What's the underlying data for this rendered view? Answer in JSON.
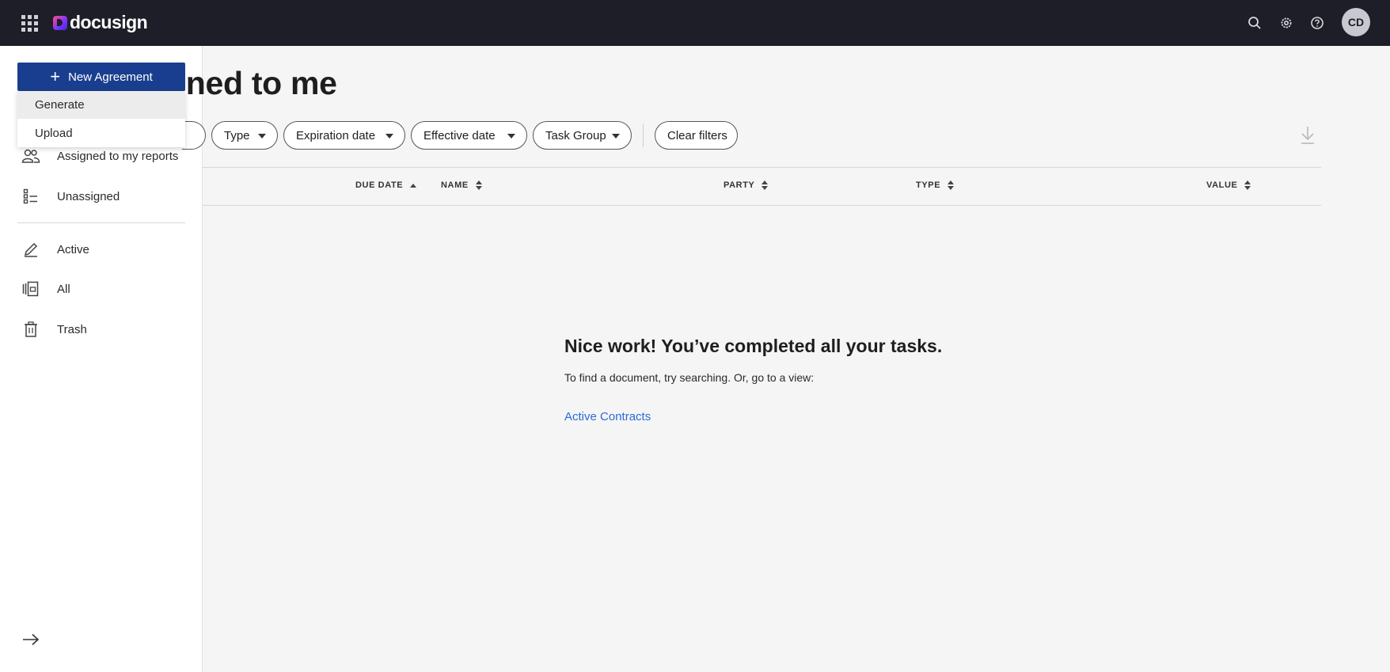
{
  "topbar": {
    "logo_text": "docusign",
    "avatar_initials": "CD",
    "icons": [
      "apps-grid-icon",
      "search-icon",
      "gear-icon",
      "help-icon"
    ]
  },
  "new_agreement": {
    "label": "New Agreement",
    "menu": [
      "Generate",
      "Upload"
    ]
  },
  "sidebar": {
    "items": [
      {
        "label": "Assigned to my reports",
        "icon": "people-icon"
      },
      {
        "label": "Unassigned",
        "icon": "list-icon"
      },
      {
        "label": "Active",
        "icon": "pen-icon"
      },
      {
        "label": "All",
        "icon": "documents-icon"
      },
      {
        "label": "Trash",
        "icon": "trash-icon"
      }
    ]
  },
  "page": {
    "title": "gned to me"
  },
  "filters": {
    "chips": [
      "Type",
      "Expiration date",
      "Effective date",
      "Task Group"
    ],
    "clear_label": "Clear filters"
  },
  "table": {
    "columns": [
      "DUE DATE",
      "NAME",
      "PARTY",
      "TYPE",
      "VALUE"
    ]
  },
  "empty_state": {
    "title": "Nice work! You’ve completed all your tasks.",
    "subtitle": "To find a document, try searching. Or, go to a view:",
    "link": "Active Contracts"
  },
  "colors": {
    "topbar": "#1e1e28",
    "primary_button": "#1a3e8f",
    "link": "#2a6ad8"
  }
}
